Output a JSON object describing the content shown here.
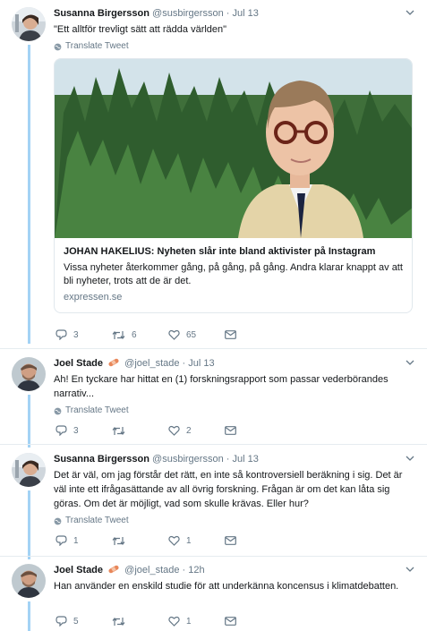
{
  "translate_label": "Translate Tweet",
  "tweets": [
    {
      "name": "Susanna Birgersson",
      "handle": "@susbirgersson",
      "dot": "·",
      "time": "Jul 13",
      "text": "\"Ett alltför trevligt sätt att rädda världen\"",
      "card": {
        "title": "JOHAN HAKELIUS: Nyheten slår inte bland aktivister på Instagram",
        "description": "Vissa nyheter återkommer gång, på gång, på gång. Andra klarar knappt av att bli nyheter, trots att de är det.",
        "domain": "expressen.se"
      },
      "replies": "3",
      "retweets": "6",
      "likes": "65"
    },
    {
      "name": "Joel Stade",
      "handle": "@joel_stade",
      "dot": "·",
      "time": "Jul 13",
      "text": "Ah! En tyckare har hittat en (1) forskningsrapport som passar vederbörandes narrativ...",
      "replies": "3",
      "retweets": "",
      "likes": "2"
    },
    {
      "name": "Susanna Birgersson",
      "handle": "@susbirgersson",
      "dot": "·",
      "time": "Jul 13",
      "text": "Det är väl, om jag förstår det rätt, en inte så kontroversiell beräkning i sig. Det är väl inte ett ifrågasättande av all övrig forskning. Frågan är om det kan låta sig göras. Om det är möjligt, vad som skulle krävas. Eller hur?",
      "replies": "1",
      "retweets": "",
      "likes": "1"
    },
    {
      "name": "Joel Stade",
      "handle": "@joel_stade",
      "dot": "·",
      "time": "12h",
      "text": "Han använder en enskild studie för att underkänna koncensus i klimatdebatten.",
      "replies": "5",
      "retweets": "",
      "likes": "1"
    }
  ]
}
